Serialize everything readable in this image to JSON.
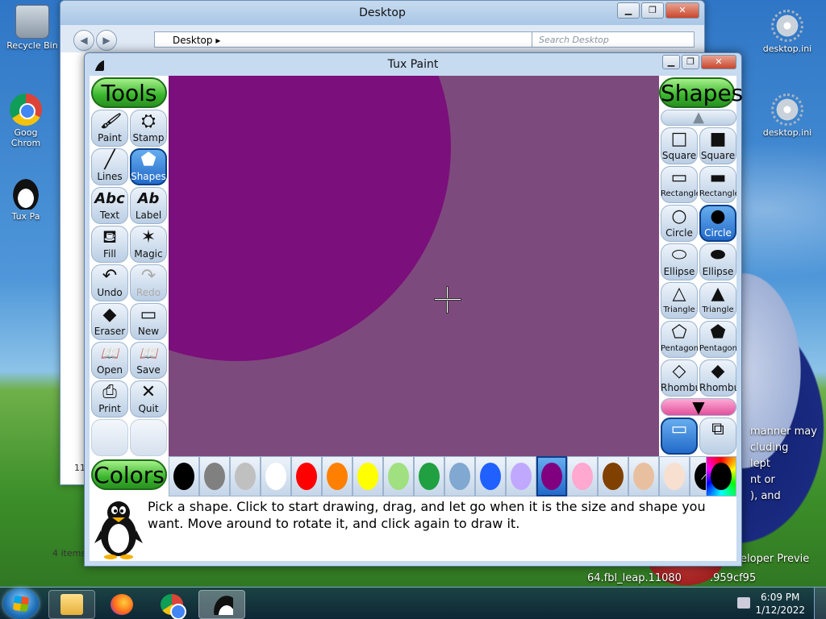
{
  "desktop": {
    "icons": [
      {
        "label": "Recycle Bin",
        "icon": "recycle-bin-icon"
      },
      {
        "label": "Goog Chrom",
        "icon": "chrome-icon"
      },
      {
        "label": "Tux Pa",
        "icon": "tux-icon"
      },
      {
        "label": "desktop.ini",
        "icon": "settings-file-icon"
      },
      {
        "label": "desktop.ini",
        "icon": "settings-file-icon"
      }
    ],
    "bg_text": [
      "manner may",
      "cluding",
      "lept",
      "nt or",
      "), and",
      "eloper Previe",
      "64.fbl_leap.11080",
      ".959cf95"
    ]
  },
  "explorer": {
    "title": "Desktop",
    "address": "Desktop",
    "search_placeholder": "Search Desktop",
    "item_count": "4 items",
    "side_number": "11"
  },
  "tuxpaint": {
    "title": "Tux Paint",
    "tools_header": "Tools",
    "tools": [
      {
        "label": "Paint",
        "glyph": "🖌",
        "icon": "paintbrush-icon",
        "selected": false,
        "disabled": false
      },
      {
        "label": "Stamp",
        "glyph": "⛭",
        "icon": "stamp-icon",
        "selected": false,
        "disabled": false
      },
      {
        "label": "Lines",
        "glyph": "╱",
        "icon": "lines-icon",
        "selected": false,
        "disabled": false
      },
      {
        "label": "Shapes",
        "glyph": "⬟",
        "icon": "pentagon-icon",
        "selected": true,
        "disabled": false
      },
      {
        "label": "Text",
        "glyph": "Abc",
        "icon": "text-icon",
        "selected": false,
        "disabled": false
      },
      {
        "label": "Label",
        "glyph": "Ab",
        "icon": "label-icon",
        "selected": false,
        "disabled": false
      },
      {
        "label": "Fill",
        "glyph": "⛾",
        "icon": "paint-bucket-icon",
        "selected": false,
        "disabled": false
      },
      {
        "label": "Magic",
        "glyph": "✶",
        "icon": "magic-wand-icon",
        "selected": false,
        "disabled": false
      },
      {
        "label": "Undo",
        "glyph": "↶",
        "icon": "undo-icon",
        "selected": false,
        "disabled": false
      },
      {
        "label": "Redo",
        "glyph": "↷",
        "icon": "redo-icon",
        "selected": false,
        "disabled": true
      },
      {
        "label": "Eraser",
        "glyph": "◆",
        "icon": "eraser-icon",
        "selected": false,
        "disabled": false
      },
      {
        "label": "New",
        "glyph": "▭",
        "icon": "new-page-icon",
        "selected": false,
        "disabled": false
      },
      {
        "label": "Open",
        "glyph": "📖",
        "icon": "open-book-icon",
        "selected": false,
        "disabled": false
      },
      {
        "label": "Save",
        "glyph": "📖",
        "icon": "save-book-icon",
        "selected": false,
        "disabled": false
      },
      {
        "label": "Print",
        "glyph": "⎙",
        "icon": "printer-icon",
        "selected": false,
        "disabled": false
      },
      {
        "label": "Quit",
        "glyph": "✕",
        "icon": "quit-icon",
        "selected": false,
        "disabled": false
      }
    ],
    "shapes_header": "Shapes",
    "shapes": [
      {
        "label": "Square",
        "glyph": "□",
        "icon": "square-outline-icon",
        "selected": false
      },
      {
        "label": "Square",
        "glyph": "■",
        "icon": "square-filled-icon",
        "selected": false
      },
      {
        "label": "Rectangle",
        "glyph": "▭",
        "icon": "rectangle-outline-icon",
        "selected": false
      },
      {
        "label": "Rectangle",
        "glyph": "▬",
        "icon": "rectangle-filled-icon",
        "selected": false
      },
      {
        "label": "Circle",
        "glyph": "○",
        "icon": "circle-outline-icon",
        "selected": false
      },
      {
        "label": "Circle",
        "glyph": "●",
        "icon": "circle-filled-icon",
        "selected": true
      },
      {
        "label": "Ellipse",
        "glyph": "⬭",
        "icon": "ellipse-outline-icon",
        "selected": false
      },
      {
        "label": "Ellipse",
        "glyph": "⬬",
        "icon": "ellipse-filled-icon",
        "selected": false
      },
      {
        "label": "Triangle",
        "glyph": "△",
        "icon": "triangle-outline-icon",
        "selected": false
      },
      {
        "label": "Triangle",
        "glyph": "▲",
        "icon": "triangle-filled-icon",
        "selected": false
      },
      {
        "label": "Pentagon",
        "glyph": "⬠",
        "icon": "pentagon-outline-icon",
        "selected": false
      },
      {
        "label": "Pentagon",
        "glyph": "⬟",
        "icon": "pentagon-filled-icon",
        "selected": false
      },
      {
        "label": "Rhombus",
        "glyph": "◇",
        "icon": "rhombus-outline-icon",
        "selected": false
      },
      {
        "label": "Rhombus",
        "glyph": "◆",
        "icon": "rhombus-filled-icon",
        "selected": false
      }
    ],
    "colors_header": "Colors",
    "colors": [
      {
        "hex": "#000000",
        "selected": false
      },
      {
        "hex": "#808080",
        "selected": false
      },
      {
        "hex": "#c0c0c0",
        "selected": false
      },
      {
        "hex": "#ffffff",
        "selected": false
      },
      {
        "hex": "#ff0000",
        "selected": false
      },
      {
        "hex": "#ff8000",
        "selected": false
      },
      {
        "hex": "#ffff00",
        "selected": false
      },
      {
        "hex": "#a0e080",
        "selected": false
      },
      {
        "hex": "#20a040",
        "selected": false
      },
      {
        "hex": "#80a8d0",
        "selected": false
      },
      {
        "hex": "#2060ff",
        "selected": false
      },
      {
        "hex": "#c0a8ff",
        "selected": false
      },
      {
        "hex": "#800080",
        "selected": true
      },
      {
        "hex": "#ffa8d0",
        "selected": false
      },
      {
        "hex": "#804000",
        "selected": false
      },
      {
        "hex": "#e8c0a0",
        "selected": false
      },
      {
        "hex": "#f8e0d0",
        "selected": false
      }
    ],
    "canvas_bg": "#7d4a7d",
    "circle_color": "#7b0f7b",
    "status_message": "Pick a shape. Click to start drawing, drag, and let go when it is the size and shape you want. Move around to rotate it, and click again to draw it."
  },
  "taskbar": {
    "time": "6:09 PM",
    "date": "1/12/2022",
    "apps": [
      "file-explorer-icon",
      "firefox-icon",
      "chrome-icon",
      "tux-paint-icon"
    ]
  }
}
